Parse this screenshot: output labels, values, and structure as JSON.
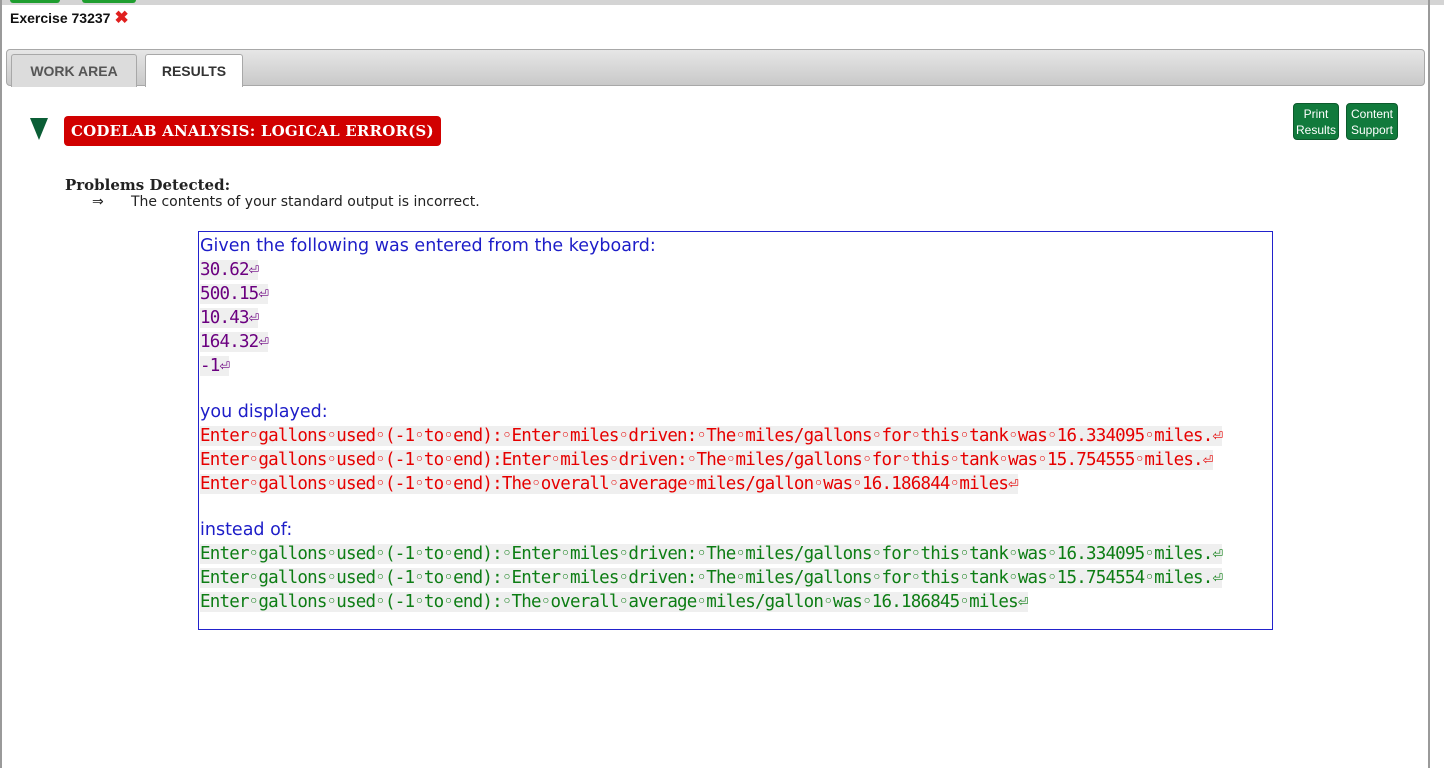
{
  "window": {
    "title": "Exercise 73237",
    "close_glyph": "✖"
  },
  "tabs": [
    {
      "label": "WORK AREA"
    },
    {
      "label": "RESULTS"
    }
  ],
  "analysis": {
    "banner": "CODELAB ANALYSIS: LOGICAL ERROR(S)",
    "print_button": [
      "Print",
      "Results"
    ],
    "support_button": [
      "Content",
      "Support"
    ],
    "problems_heading": "Problems Detected:",
    "problem_arrow": "⇒",
    "problem_text": "The contents of your standard output is incorrect."
  },
  "output": {
    "given_heading": "Given the following was entered from the keyboard:",
    "inputs": [
      "30.62⏎",
      "500.15⏎",
      "10.43⏎",
      "164.32⏎",
      "-1⏎"
    ],
    "displayed_heading": "you displayed:",
    "displayed": [
      "Enter◦gallons◦used◦(-1◦to◦end):◦Enter◦miles◦driven:◦The◦miles/gallons◦for◦this◦tank◦was◦16.334095◦miles.⏎",
      "Enter◦gallons◦used◦(-1◦to◦end):Enter◦miles◦driven:◦The◦miles/gallons◦for◦this◦tank◦was◦15.754555◦miles.⏎",
      "Enter◦gallons◦used◦(-1◦to◦end):The◦overall◦average◦miles/gallon◦was◦16.186844◦miles⏎"
    ],
    "expected_heading": "instead of:",
    "expected": [
      "Enter◦gallons◦used◦(-1◦to◦end):◦Enter◦miles◦driven:◦The◦miles/gallons◦for◦this◦tank◦was◦16.334095◦miles.⏎",
      "Enter◦gallons◦used◦(-1◦to◦end):◦Enter◦miles◦driven:◦The◦miles/gallons◦for◦this◦tank◦was◦15.754554◦miles.⏎",
      "Enter◦gallons◦used◦(-1◦to◦end):◦The◦overall◦average◦miles/gallon◦was◦16.186845◦miles⏎"
    ]
  },
  "colors": {
    "banner_bg": "#d10000",
    "button_green": "#117a3c",
    "header_blue": "#1d1dc8",
    "input_purple": "#6b0080",
    "displayed_red": "#e60000",
    "expected_green": "#0d7d14"
  }
}
